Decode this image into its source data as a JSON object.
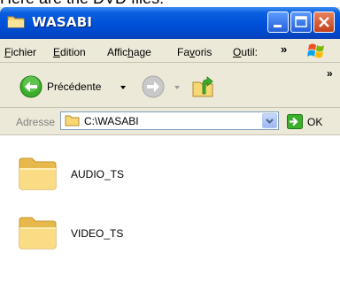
{
  "caption": "Here are the DVD files:",
  "window": {
    "title": "WASABI"
  },
  "menu": {
    "items": [
      "Fichier",
      "Edition",
      "Affichage",
      "Favoris",
      "Outils"
    ],
    "underline": [
      "F",
      "E",
      "h",
      "v",
      "O"
    ],
    "more": "»"
  },
  "toolbar": {
    "back_label": "Précédente",
    "more": "»"
  },
  "address": {
    "label": "Adresse",
    "value": "C:\\WASABI",
    "go_label": "OK"
  },
  "files": [
    {
      "name": "AUDIO_TS",
      "icon": "folder-icon"
    },
    {
      "name": "VIDEO_TS",
      "icon": "folder-icon"
    }
  ],
  "colors": {
    "titlebar": "#0050d8",
    "chrome": "#ece9d8",
    "folder": "#f7d774"
  }
}
